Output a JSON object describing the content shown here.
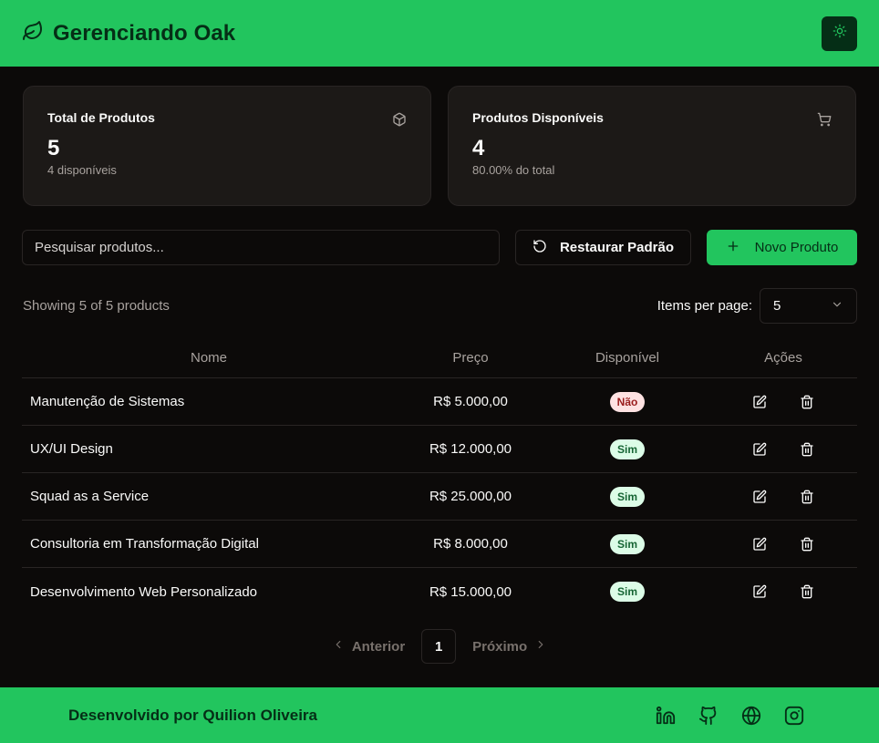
{
  "header": {
    "title": "Gerenciando Oak",
    "logo_icon": "leaf-icon",
    "theme_icon": "sun-icon"
  },
  "stats": [
    {
      "title": "Total de Produtos",
      "value": "5",
      "sub": "4 disponíveis",
      "icon": "package-icon"
    },
    {
      "title": "Produtos Disponíveis",
      "value": "4",
      "sub": "80.00% do total",
      "icon": "cart-icon"
    }
  ],
  "toolbar": {
    "search_placeholder": "Pesquisar produtos...",
    "restore_label": "Restaurar Padrão",
    "new_label": "Novo Produto"
  },
  "list_info": {
    "showing": "Showing 5 of 5 products",
    "per_page_label": "Items per page:",
    "per_page_value": "5"
  },
  "table": {
    "headers": {
      "name": "Nome",
      "price": "Preço",
      "available": "Disponível",
      "actions": "Ações"
    },
    "rows": [
      {
        "name": "Manutenção de Sistemas",
        "price": "R$ 5.000,00",
        "available": "Não",
        "available_flag": false
      },
      {
        "name": "UX/UI Design",
        "price": "R$ 12.000,00",
        "available": "Sim",
        "available_flag": true
      },
      {
        "name": "Squad as a Service",
        "price": "R$ 25.000,00",
        "available": "Sim",
        "available_flag": true
      },
      {
        "name": "Consultoria em Transformação Digital",
        "price": "R$ 8.000,00",
        "available": "Sim",
        "available_flag": true
      },
      {
        "name": "Desenvolvimento Web Personalizado",
        "price": "R$ 15.000,00",
        "available": "Sim",
        "available_flag": true
      }
    ]
  },
  "pagination": {
    "prev_label": "Anterior",
    "current_page": "1",
    "next_label": "Próximo"
  },
  "footer": {
    "credit": "Desenvolvido por Quilion Oliveira",
    "social_icons": [
      "linkedin-icon",
      "github-icon",
      "globe-icon",
      "instagram-icon"
    ]
  },
  "colors": {
    "brand_green": "#22c55e",
    "dark_green": "#052e16",
    "background": "#0c0a09",
    "card": "#1c1917"
  }
}
